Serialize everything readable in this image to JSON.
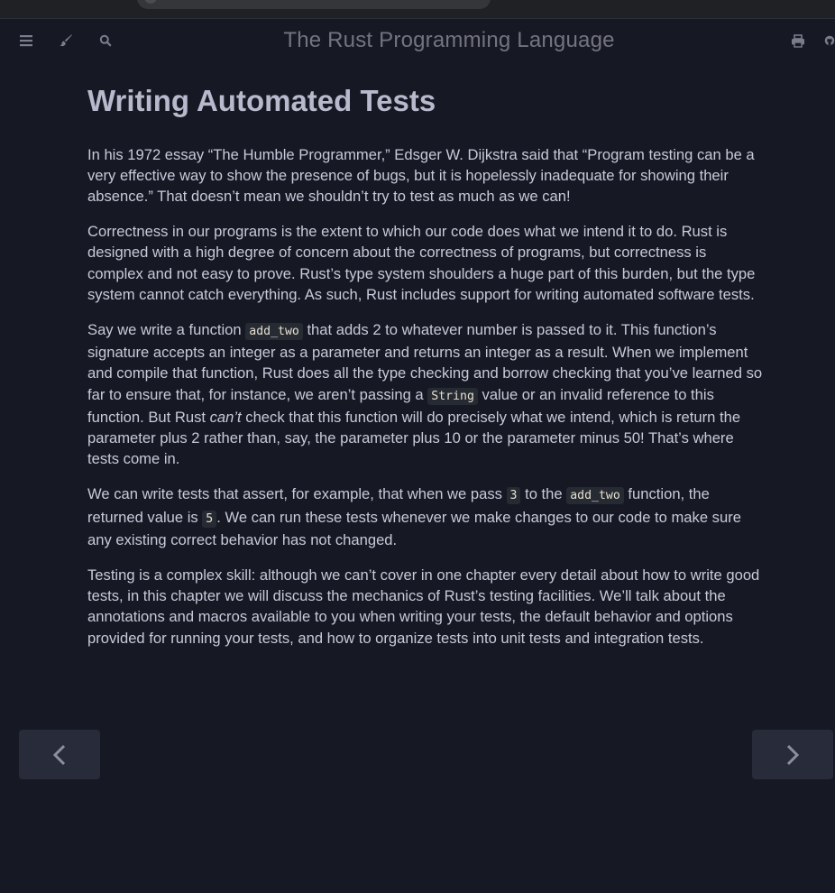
{
  "header": {
    "title": "The Rust Programming Language",
    "left_icons": [
      "menu-icon",
      "paintbrush-icon",
      "search-icon"
    ],
    "right_icons": [
      "print-icon",
      "github-icon"
    ]
  },
  "article": {
    "heading": "Writing Automated Tests",
    "p1": "In his 1972 essay “The Humble Programmer,” Edsger W. Dijkstra said that “Program testing can be a very effective way to show the presence of bugs, but it is hopelessly inadequate for showing their absence.” That doesn’t mean we shouldn’t try to test as much as we can!",
    "p2": "Correctness in our programs is the extent to which our code does what we intend it to do. Rust is designed with a high degree of concern about the correctness of programs, but correctness is complex and not easy to prove. Rust’s type system shoulders a huge part of this burden, but the type system cannot catch everything. As such, Rust includes support for writing automated software tests.",
    "p3": {
      "t1": "Say we write a function ",
      "c1": "add_two",
      "t2": " that adds 2 to whatever number is passed to it. This function’s signature accepts an integer as a parameter and returns an integer as a result. When we implement and compile that function, Rust does all the type checking and borrow checking that you’ve learned so far to ensure that, for instance, we aren’t passing a ",
      "c2": "String",
      "t3": " value or an invalid reference to this function. But Rust ",
      "em": "can’t",
      "t4": " check that this function will do precisely what we intend, which is return the parameter plus 2 rather than, say, the parameter plus 10 or the parameter minus 50! That’s where tests come in."
    },
    "p4": {
      "t1": "We can write tests that assert, for example, that when we pass ",
      "c1": "3",
      "t2": " to the ",
      "c2": "add_two",
      "t3": " function, the returned value is ",
      "c3": "5",
      "t4": ". We can run these tests whenever we make changes to our code to make sure any existing correct behavior has not changed."
    },
    "p5": "Testing is a complex skill: although we can’t cover in one chapter every detail about how to write good tests, in this chapter we will discuss the mechanics of Rust’s testing facilities. We’ll talk about the annotations and macros available to you when writing your tests, the default behavior and options provided for running your tests, and how to organize tests into unit tests and integration tests."
  },
  "navigation": {
    "prev_icon": "chevron-left-icon",
    "next_icon": "chevron-right-icon"
  },
  "colors": {
    "background": "#161923",
    "text": "#c8c9db",
    "heading": "#b7b9cc",
    "title": "#737480",
    "nav_button": "#282c3a"
  }
}
